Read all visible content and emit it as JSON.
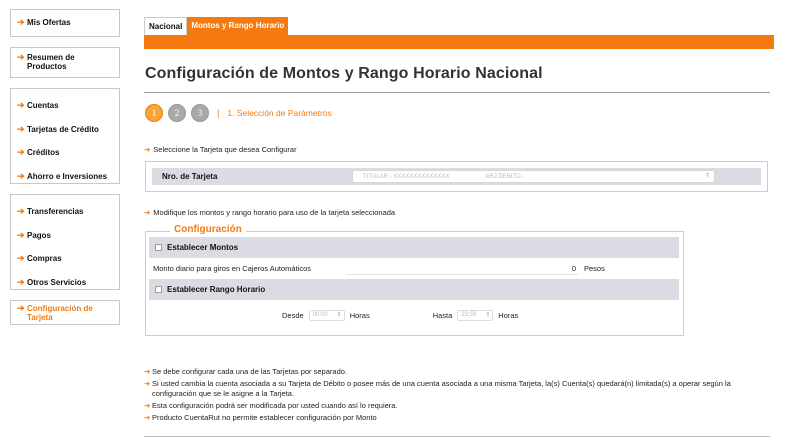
{
  "sidebar": {
    "ofertas": "Mis Ofertas",
    "resumen": "Resumen de Productos",
    "cuentas": "Cuentas",
    "tarjetas": "Tarjetas de Crédito",
    "creditos": "Créditos",
    "ahorro": "Ahorro e Inversiones",
    "transferencias": "Transferencias",
    "pagos": "Pagos",
    "compras": "Compras",
    "otros": "Otros Servicios",
    "config": "Configuración de Tarjeta",
    "arrow": "➔"
  },
  "tabs": {
    "nacional": "Nacional",
    "montos": "Montos y Rango Horario"
  },
  "page_title": "Configuración de Montos y Rango Horario Nacional",
  "steps": {
    "one": "1",
    "two": "2",
    "three": "3",
    "separator": "|",
    "label": "1. Selección de Parámetros"
  },
  "instructions": {
    "select_card": "Seleccione la Tarjeta que desea Configurar",
    "modify": "Modifique los montos y rango horario para uso de la tarjeta seleccionada"
  },
  "card": {
    "label": "Nro. de Tarjeta",
    "titular": "TITULAR - XXXXXXXXXXXXXX",
    "type": "ARJ.DEBITO -"
  },
  "config": {
    "legend": "Configuración",
    "montos_label": "Establecer Montos",
    "monto_diario_label": "Monto diario para giros en Cajeros Automáticos",
    "monto_value": "0",
    "monto_unit": "Pesos",
    "rango_label": "Establecer Rango Horario",
    "desde_label": "Desde",
    "desde_value": "00:00",
    "hasta_label": "Hasta",
    "hasta_value": "23:59",
    "horas": "Horas"
  },
  "notes": [
    "Se debe configurar cada una de las Tarjetas por separado.",
    "Si usted cambia la cuenta asociada a su Tarjeta de Débito o posee más de una cuenta asociada a una misma Tarjeta, la(s) Cuenta(s) quedará(n) limitada(s) a operar según la configuración que se le asigne a la Tarjeta.",
    "Esta configuración podrá ser modificada por usted cuando así lo requiera.",
    "Producto CuentaRut no permite establecer configuración por Monto"
  ],
  "colors": {
    "accent": "#f47a10",
    "row_bg": "#dcdbe3"
  }
}
